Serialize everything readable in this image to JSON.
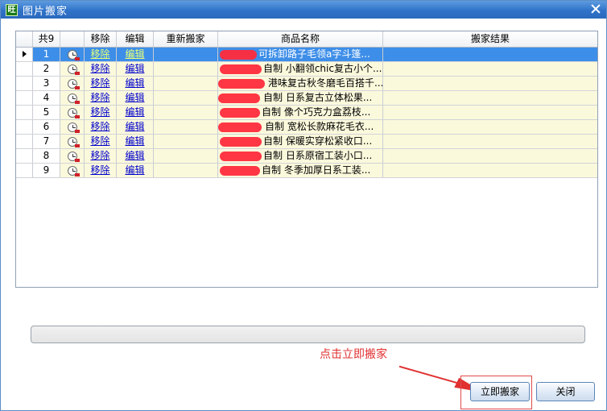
{
  "window": {
    "title": "图片搬家",
    "app_icon_text": "旺",
    "close_icon": "close-icon"
  },
  "grid": {
    "headers": {
      "count": "共9",
      "remove": "移除",
      "edit": "编辑",
      "re_move": "重新搬家",
      "product_name": "商品名称",
      "result": "搬家结果"
    },
    "rows": [
      {
        "num": "1",
        "remove": "移除",
        "edit": "编辑",
        "name": "可拆卸路子毛领a字斗篷...",
        "selected": true
      },
      {
        "num": "2",
        "remove": "移除",
        "edit": "编辑",
        "name": "自制 小翻领chic复古小个..."
      },
      {
        "num": "3",
        "remove": "移除",
        "edit": "编辑",
        "name": "港味复古秋冬磨毛百搭千..."
      },
      {
        "num": "4",
        "remove": "移除",
        "edit": "编辑",
        "name": "自制 日系复古立体松果..."
      },
      {
        "num": "5",
        "remove": "移除",
        "edit": "编辑",
        "name": "自制 像个巧克力盒荔枝..."
      },
      {
        "num": "6",
        "remove": "移除",
        "edit": "编辑",
        "name": "自制 宽松长款麻花毛衣..."
      },
      {
        "num": "7",
        "remove": "移除",
        "edit": "编辑",
        "name": "自制 保暖实穿松紧收口..."
      },
      {
        "num": "8",
        "remove": "移除",
        "edit": "编辑",
        "name": "自制 日系原宿工装小口..."
      },
      {
        "num": "9",
        "remove": "移除",
        "edit": "编辑",
        "name": "自制 冬季加厚日系工装..."
      }
    ]
  },
  "annotation": {
    "text": "点击立即搬家",
    "color": "#e03030"
  },
  "buttons": {
    "move_now": "立即搬家",
    "close": "关闭"
  },
  "colors": {
    "titlebar": "#2f73c9",
    "selected_row": "#3d8ee8",
    "row_bg": "#fbf9dc",
    "redaction": "#ff2b3b"
  }
}
